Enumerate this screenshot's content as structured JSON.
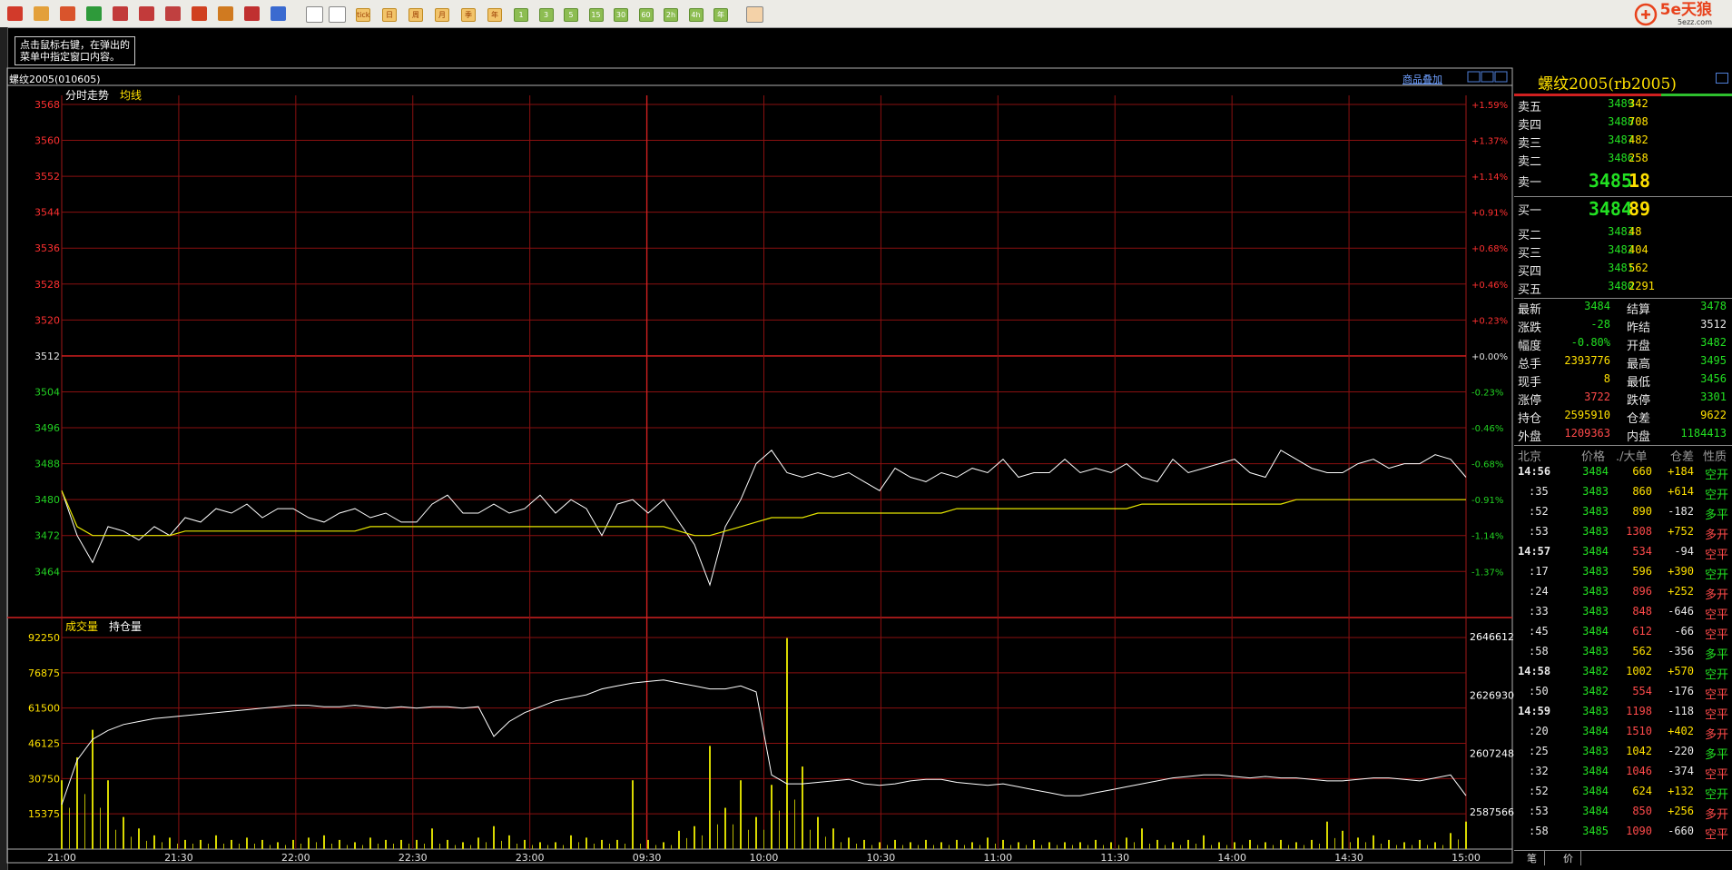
{
  "toolbar": {
    "icons": [
      "home-icon",
      "pages-icon",
      "tv-icon",
      "refresh-icon",
      "zoom-in-icon",
      "zoom-out-icon",
      "window-icon",
      "pen-icon",
      "brush-icon",
      "filter-icon",
      "grid-icon"
    ],
    "period_buttons": [
      "tick",
      "日",
      "周",
      "月",
      "季",
      "年",
      "1",
      "3",
      "5",
      "15",
      "30",
      "60",
      "2h",
      "4h",
      "年"
    ],
    "logo_text": "5e天狼",
    "logo_sub": "5ezz.com"
  },
  "hint": {
    "line1": "点击鼠标右键，在弹出的",
    "line2": "菜单中指定窗口内容。"
  },
  "chart": {
    "instrument_title": "螺纹2005(010605)",
    "overlay_link": "商品叠加",
    "legend_price": "分时走势",
    "legend_avg": "均线",
    "legend_volume": "成交量",
    "legend_oi": "持仓量"
  },
  "chart_data": {
    "type": "line",
    "prev_settle": 3512,
    "price_ticks": [
      "3568",
      "3560",
      "3552",
      "3544",
      "3536",
      "3528",
      "3520",
      "3512",
      "3504",
      "3496",
      "3488",
      "3480",
      "3472",
      "3464"
    ],
    "pct_ticks": [
      "+1.59%",
      "+1.37%",
      "+1.14%",
      "+0.91%",
      "+0.68%",
      "+0.46%",
      "+0.23%",
      "+0.00%",
      "-0.23%",
      "-0.46%",
      "-0.68%",
      "-0.91%",
      "-1.14%",
      "-1.37%"
    ],
    "volume_ticks": [
      "92250",
      "76875",
      "61500",
      "46125",
      "30750",
      "15375"
    ],
    "oi_ticks": [
      "2646612",
      "2626930",
      "2607248",
      "2587566"
    ],
    "time_labels": [
      "21:00",
      "21:30",
      "22:00",
      "22:30",
      "23:00",
      "09:30",
      "10:00",
      "10:30",
      "11:00",
      "11:30",
      "14:00",
      "14:30",
      "15:00"
    ],
    "price_series": [
      3482,
      3472,
      3466,
      3474,
      3473,
      3471,
      3474,
      3472,
      3476,
      3475,
      3478,
      3477,
      3479,
      3476,
      3478,
      3478,
      3476,
      3475,
      3477,
      3478,
      3476,
      3477,
      3475,
      3475,
      3479,
      3481,
      3477,
      3477,
      3479,
      3477,
      3478,
      3481,
      3477,
      3480,
      3478,
      3472,
      3479,
      3480,
      3477,
      3480,
      3475,
      3470,
      3461,
      3474,
      3480,
      3488,
      3491,
      3486,
      3485,
      3486,
      3485,
      3486,
      3484,
      3482,
      3487,
      3485,
      3484,
      3486,
      3485,
      3487,
      3486,
      3489,
      3485,
      3486,
      3486,
      3489,
      3486,
      3487,
      3486,
      3488,
      3485,
      3484,
      3489,
      3486,
      3487,
      3488,
      3489,
      3486,
      3485,
      3491,
      3489,
      3487,
      3486,
      3486,
      3488,
      3489,
      3487,
      3488,
      3488,
      3490,
      3489,
      3485
    ],
    "avg_series": [
      3482,
      3474,
      3472,
      3472,
      3472,
      3472,
      3472,
      3472,
      3473,
      3473,
      3473,
      3473,
      3473,
      3473,
      3473,
      3473,
      3473,
      3473,
      3473,
      3473,
      3474,
      3474,
      3474,
      3474,
      3474,
      3474,
      3474,
      3474,
      3474,
      3474,
      3474,
      3474,
      3474,
      3474,
      3474,
      3474,
      3474,
      3474,
      3474,
      3474,
      3473,
      3472,
      3472,
      3473,
      3474,
      3475,
      3476,
      3476,
      3476,
      3477,
      3477,
      3477,
      3477,
      3477,
      3477,
      3477,
      3477,
      3477,
      3478,
      3478,
      3478,
      3478,
      3478,
      3478,
      3478,
      3478,
      3478,
      3478,
      3478,
      3478,
      3479,
      3479,
      3479,
      3479,
      3479,
      3479,
      3479,
      3479,
      3479,
      3479,
      3480,
      3480,
      3480,
      3480,
      3480,
      3480,
      3480,
      3480,
      3480,
      3480,
      3480,
      3480
    ],
    "oi_series": [
      2590000,
      2605000,
      2612000,
      2615000,
      2617000,
      2618000,
      2619000,
      2619500,
      2620000,
      2620500,
      2621000,
      2621500,
      2622000,
      2622500,
      2623000,
      2623500,
      2623500,
      2623000,
      2623000,
      2623500,
      2623000,
      2622500,
      2623000,
      2622500,
      2623000,
      2623000,
      2622500,
      2623000,
      2613000,
      2618000,
      2621000,
      2623000,
      2625000,
      2626000,
      2627000,
      2629000,
      2630000,
      2631000,
      2631500,
      2632000,
      2631000,
      2630000,
      2629000,
      2629000,
      2630000,
      2628000,
      2600000,
      2597000,
      2597000,
      2597500,
      2598000,
      2598500,
      2597000,
      2596500,
      2597000,
      2598000,
      2598500,
      2598500,
      2597500,
      2597000,
      2596500,
      2597000,
      2596000,
      2595000,
      2594000,
      2593000,
      2593000,
      2594000,
      2595000,
      2596000,
      2597000,
      2598000,
      2599000,
      2599500,
      2600000,
      2600000,
      2599500,
      2599000,
      2599500,
      2599000,
      2599000,
      2598500,
      2598000,
      2598000,
      2598500,
      2599000,
      2599000,
      2598500,
      2598000,
      2599000,
      2600000,
      2593000
    ],
    "volume_series": [
      30000,
      40000,
      52000,
      30000,
      14000,
      9000,
      6000,
      5000,
      4000,
      4000,
      6000,
      4000,
      5000,
      4000,
      3000,
      4000,
      5000,
      6000,
      4000,
      3000,
      5000,
      4000,
      4000,
      4000,
      9000,
      4000,
      3000,
      5000,
      10000,
      6000,
      4000,
      3000,
      3000,
      6000,
      5000,
      4000,
      4000,
      30000,
      4000,
      3000,
      8000,
      10000,
      45000,
      18000,
      30000,
      14000,
      28000,
      92000,
      36000,
      14000,
      9000,
      5000,
      4000,
      3000,
      4000,
      3000,
      4000,
      3000,
      4000,
      3000,
      5000,
      4000,
      3000,
      4000,
      3000,
      3000,
      3000,
      4000,
      3000,
      5000,
      9000,
      4000,
      3000,
      4000,
      6000,
      3000,
      3000,
      4000,
      3000,
      4000,
      3000,
      4000,
      12000,
      8000,
      5000,
      6000,
      4000,
      3000,
      4000,
      3000,
      7000,
      12000
    ]
  },
  "quote": {
    "title": "螺纹2005(rb2005)",
    "asks": [
      {
        "label": "卖五",
        "price": "3489",
        "vol": "342"
      },
      {
        "label": "卖四",
        "price": "3488",
        "vol": "708"
      },
      {
        "label": "卖三",
        "price": "3487",
        "vol": "482"
      },
      {
        "label": "卖二",
        "price": "3486",
        "vol": "258"
      },
      {
        "label": "卖一",
        "price": "3485",
        "vol": "18"
      }
    ],
    "bids": [
      {
        "label": "买一",
        "price": "3484",
        "vol": "89"
      },
      {
        "label": "买二",
        "price": "3483",
        "vol": "48"
      },
      {
        "label": "买三",
        "price": "3482",
        "vol": "404"
      },
      {
        "label": "买四",
        "price": "3481",
        "vol": "562"
      },
      {
        "label": "买五",
        "price": "3480",
        "vol": "2291"
      }
    ],
    "stats": [
      {
        "l1": "最新",
        "v1": "3484",
        "c1": "g",
        "l2": "结算",
        "v2": "3478",
        "c2": "g"
      },
      {
        "l1": "涨跌",
        "v1": "-28",
        "c1": "g",
        "l2": "昨结",
        "v2": "3512",
        "c2": "w"
      },
      {
        "l1": "幅度",
        "v1": "-0.80%",
        "c1": "g",
        "l2": "开盘",
        "v2": "3482",
        "c2": "g"
      },
      {
        "l1": "总手",
        "v1": "2393776",
        "c1": "y",
        "l2": "最高",
        "v2": "3495",
        "c2": "g"
      },
      {
        "l1": "现手",
        "v1": "8",
        "c1": "y",
        "l2": "最低",
        "v2": "3456",
        "c2": "g"
      },
      {
        "l1": "涨停",
        "v1": "3722",
        "c1": "r",
        "l2": "跌停",
        "v2": "3301",
        "c2": "g"
      },
      {
        "l1": "持仓",
        "v1": "2595910",
        "c1": "y",
        "l2": "仓差",
        "v2": "9622",
        "c2": "y"
      },
      {
        "l1": "外盘",
        "v1": "1209363",
        "c1": "r",
        "l2": "内盘",
        "v2": "1184413",
        "c2": "g"
      }
    ],
    "trade_header": {
      "time": "北京",
      "price": "价格",
      "big": "./大单",
      "oi": "仓差",
      "nature": "性质"
    },
    "trades": [
      {
        "t": "14:56",
        "p": "3484",
        "pc": "g",
        "v": "660",
        "vc": "y",
        "d": "+184",
        "dc": "y",
        "n": "空开",
        "nc": "g",
        "big": true
      },
      {
        "t": ":35",
        "p": "3483",
        "pc": "g",
        "v": "860",
        "vc": "y",
        "d": "+614",
        "dc": "y",
        "n": "空开",
        "nc": "g"
      },
      {
        "t": ":52",
        "p": "3483",
        "pc": "g",
        "v": "890",
        "vc": "y",
        "d": "-182",
        "dc": "w",
        "n": "多平",
        "nc": "g"
      },
      {
        "t": ":53",
        "p": "3483",
        "pc": "g",
        "v": "1308",
        "vc": "r",
        "d": "+752",
        "dc": "y",
        "n": "多开",
        "nc": "r"
      },
      {
        "t": "14:57",
        "p": "3484",
        "pc": "g",
        "v": "534",
        "vc": "r",
        "d": "-94",
        "dc": "w",
        "n": "空平",
        "nc": "r",
        "big": true
      },
      {
        "t": ":17",
        "p": "3483",
        "pc": "g",
        "v": "596",
        "vc": "y",
        "d": "+390",
        "dc": "y",
        "n": "空开",
        "nc": "g"
      },
      {
        "t": ":24",
        "p": "3483",
        "pc": "g",
        "v": "896",
        "vc": "r",
        "d": "+252",
        "dc": "y",
        "n": "多开",
        "nc": "r"
      },
      {
        "t": ":33",
        "p": "3483",
        "pc": "g",
        "v": "848",
        "vc": "r",
        "d": "-646",
        "dc": "w",
        "n": "空平",
        "nc": "r"
      },
      {
        "t": ":45",
        "p": "3484",
        "pc": "g",
        "v": "612",
        "vc": "r",
        "d": "-66",
        "dc": "w",
        "n": "空平",
        "nc": "r"
      },
      {
        "t": ":58",
        "p": "3483",
        "pc": "g",
        "v": "562",
        "vc": "y",
        "d": "-356",
        "dc": "w",
        "n": "多平",
        "nc": "g"
      },
      {
        "t": "14:58",
        "p": "3482",
        "pc": "g",
        "v": "1002",
        "vc": "y",
        "d": "+570",
        "dc": "y",
        "n": "空开",
        "nc": "g",
        "big": true
      },
      {
        "t": ":50",
        "p": "3482",
        "pc": "g",
        "v": "554",
        "vc": "r",
        "d": "-176",
        "dc": "w",
        "n": "空平",
        "nc": "r"
      },
      {
        "t": "14:59",
        "p": "3483",
        "pc": "g",
        "v": "1198",
        "vc": "r",
        "d": "-118",
        "dc": "w",
        "n": "空平",
        "nc": "r",
        "big": true
      },
      {
        "t": ":20",
        "p": "3484",
        "pc": "g",
        "v": "1510",
        "vc": "r",
        "d": "+402",
        "dc": "y",
        "n": "多开",
        "nc": "r"
      },
      {
        "t": ":25",
        "p": "3483",
        "pc": "g",
        "v": "1042",
        "vc": "y",
        "d": "-220",
        "dc": "w",
        "n": "多平",
        "nc": "g"
      },
      {
        "t": ":32",
        "p": "3484",
        "pc": "g",
        "v": "1046",
        "vc": "r",
        "d": "-374",
        "dc": "w",
        "n": "空平",
        "nc": "r"
      },
      {
        "t": ":52",
        "p": "3484",
        "pc": "g",
        "v": "624",
        "vc": "y",
        "d": "+132",
        "dc": "y",
        "n": "空开",
        "nc": "g"
      },
      {
        "t": ":53",
        "p": "3484",
        "pc": "g",
        "v": "850",
        "vc": "r",
        "d": "+256",
        "dc": "y",
        "n": "多开",
        "nc": "r"
      },
      {
        "t": ":58",
        "p": "3485",
        "pc": "g",
        "v": "1090",
        "vc": "r",
        "d": "-660",
        "dc": "w",
        "n": "空平",
        "nc": "r"
      }
    ],
    "bottom_tabs": [
      "笔",
      "价"
    ]
  }
}
